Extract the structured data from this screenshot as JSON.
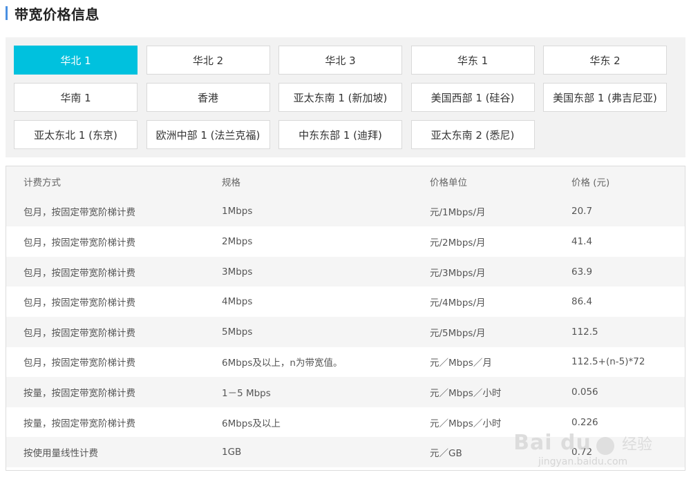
{
  "header": {
    "title": "带宽价格信息"
  },
  "regions": [
    {
      "label": "华北 1",
      "active": true
    },
    {
      "label": "华北 2",
      "active": false
    },
    {
      "label": "华北 3",
      "active": false
    },
    {
      "label": "华东 1",
      "active": false
    },
    {
      "label": "华东 2",
      "active": false
    },
    {
      "label": "华南 1",
      "active": false
    },
    {
      "label": "香港",
      "active": false
    },
    {
      "label": "亚太东南 1 (新加坡)",
      "active": false
    },
    {
      "label": "美国西部 1 (硅谷)",
      "active": false
    },
    {
      "label": "美国东部 1 (弗吉尼亚)",
      "active": false
    },
    {
      "label": "亚太东北 1 (东京)",
      "active": false
    },
    {
      "label": "欧洲中部 1 (法兰克福)",
      "active": false
    },
    {
      "label": "中东东部 1 (迪拜)",
      "active": false
    },
    {
      "label": "亚太东南 2 (悉尼)",
      "active": false
    }
  ],
  "table": {
    "headers": [
      "计费方式",
      "规格",
      "价格单位",
      "价格 (元)"
    ],
    "rows": [
      [
        "包月，按固定带宽阶梯计费",
        "1Mbps",
        "元/1Mbps/月",
        "20.7"
      ],
      [
        "包月，按固定带宽阶梯计费",
        "2Mbps",
        "元/2Mbps/月",
        "41.4"
      ],
      [
        "包月，按固定带宽阶梯计费",
        "3Mbps",
        "元/3Mbps/月",
        "63.9"
      ],
      [
        "包月，按固定带宽阶梯计费",
        "4Mbps",
        "元/4Mbps/月",
        "86.4"
      ],
      [
        "包月，按固定带宽阶梯计费",
        "5Mbps",
        "元/5Mbps/月",
        "112.5"
      ],
      [
        "包月，按固定带宽阶梯计费",
        "6Mbps及以上，n为带宽值。",
        "元／Mbps／月",
        "112.5+(n-5)*72"
      ],
      [
        "按量，按固定带宽阶梯计费",
        "1－5 Mbps",
        "元／Mbps／小时",
        "0.056"
      ],
      [
        "按量，按固定带宽阶梯计费",
        "6Mbps及以上",
        "元／Mbps／小时",
        "0.226"
      ],
      [
        "按使用量线性计费",
        "1GB",
        "元／GB",
        "0.72"
      ]
    ]
  },
  "watermark": {
    "logo": "Bai du",
    "text": "经验",
    "url": "jingyan.baidu.com"
  },
  "colors": {
    "accent": "#00c1de",
    "title_bar": "#4a90e2",
    "panel_bg": "#f2f2f2"
  }
}
